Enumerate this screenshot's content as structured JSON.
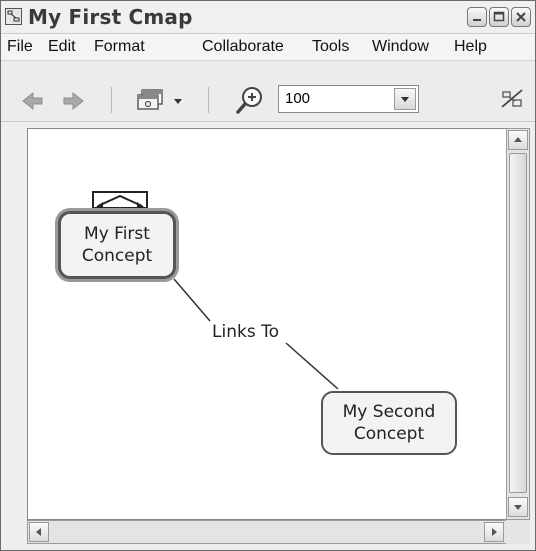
{
  "window": {
    "title": "My First Cmap",
    "icon": "cmap-app-icon",
    "controls": [
      "minimize-icon",
      "maximize-icon",
      "close-icon"
    ]
  },
  "menu": {
    "items": [
      {
        "label": "File"
      },
      {
        "label": "Edit"
      },
      {
        "label": "Format"
      },
      {
        "label": "Collaborate"
      },
      {
        "label": "Tools"
      },
      {
        "label": "Window"
      },
      {
        "label": "Help"
      }
    ]
  },
  "toolbar": {
    "back_icon": "arrow-left-icon",
    "forward_icon": "arrow-right-icon",
    "views_icon": "views-dropdown-icon",
    "zoom_icon": "zoom-in-icon",
    "zoom_value": "100",
    "network_icon": "network-off-icon"
  },
  "map": {
    "concepts": [
      {
        "label": "My First\nConcept",
        "selected": true
      },
      {
        "label": "My Second\nConcept",
        "selected": false
      }
    ],
    "link_phrase": "Links To"
  },
  "colors": {
    "canvas": "#ffffff",
    "concept_fill": "#f3f3f3",
    "concept_border": "#555555",
    "chrome": "#eeeeee"
  }
}
